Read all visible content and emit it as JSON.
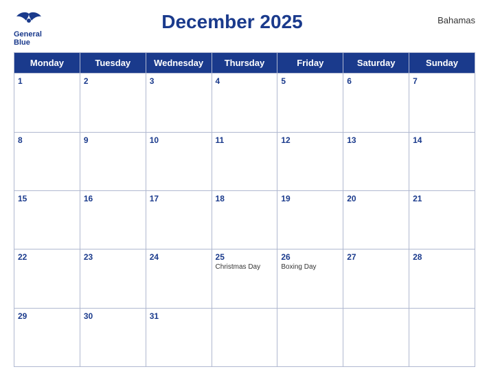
{
  "header": {
    "logo_line1": "General",
    "logo_line2": "Blue",
    "title": "December 2025",
    "country": "Bahamas"
  },
  "days": [
    "Monday",
    "Tuesday",
    "Wednesday",
    "Thursday",
    "Friday",
    "Saturday",
    "Sunday"
  ],
  "weeks": [
    [
      {
        "num": "1",
        "holiday": ""
      },
      {
        "num": "2",
        "holiday": ""
      },
      {
        "num": "3",
        "holiday": ""
      },
      {
        "num": "4",
        "holiday": ""
      },
      {
        "num": "5",
        "holiday": ""
      },
      {
        "num": "6",
        "holiday": ""
      },
      {
        "num": "7",
        "holiday": ""
      }
    ],
    [
      {
        "num": "8",
        "holiday": ""
      },
      {
        "num": "9",
        "holiday": ""
      },
      {
        "num": "10",
        "holiday": ""
      },
      {
        "num": "11",
        "holiday": ""
      },
      {
        "num": "12",
        "holiday": ""
      },
      {
        "num": "13",
        "holiday": ""
      },
      {
        "num": "14",
        "holiday": ""
      }
    ],
    [
      {
        "num": "15",
        "holiday": ""
      },
      {
        "num": "16",
        "holiday": ""
      },
      {
        "num": "17",
        "holiday": ""
      },
      {
        "num": "18",
        "holiday": ""
      },
      {
        "num": "19",
        "holiday": ""
      },
      {
        "num": "20",
        "holiday": ""
      },
      {
        "num": "21",
        "holiday": ""
      }
    ],
    [
      {
        "num": "22",
        "holiday": ""
      },
      {
        "num": "23",
        "holiday": ""
      },
      {
        "num": "24",
        "holiday": ""
      },
      {
        "num": "25",
        "holiday": "Christmas Day"
      },
      {
        "num": "26",
        "holiday": "Boxing Day"
      },
      {
        "num": "27",
        "holiday": ""
      },
      {
        "num": "28",
        "holiday": ""
      }
    ],
    [
      {
        "num": "29",
        "holiday": ""
      },
      {
        "num": "30",
        "holiday": ""
      },
      {
        "num": "31",
        "holiday": ""
      },
      {
        "num": "",
        "holiday": ""
      },
      {
        "num": "",
        "holiday": ""
      },
      {
        "num": "",
        "holiday": ""
      },
      {
        "num": "",
        "holiday": ""
      }
    ]
  ]
}
